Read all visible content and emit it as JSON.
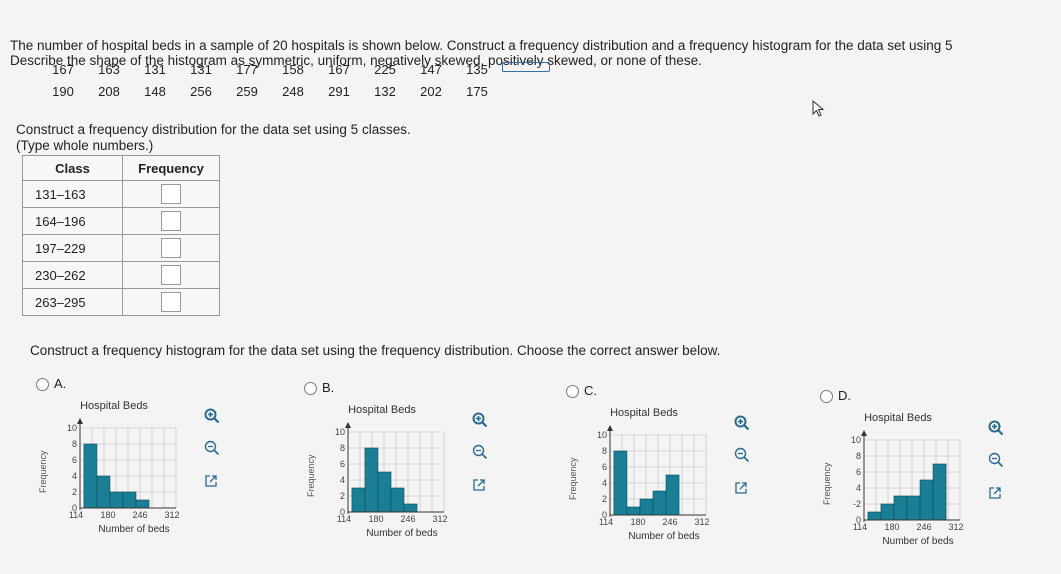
{
  "question": {
    "line1": "The number of hospital beds in a sample of 20 hospitals is shown below. Construct a frequency distribution and a frequency histogram for the data set using 5",
    "line2": "Describe the shape of the histogram as symmetric, uniform, negatively skewed, positively skewed, or none of these.",
    "row1": [
      "167",
      "163",
      "131",
      "131",
      "177",
      "158",
      "167",
      "225",
      "147",
      "135"
    ],
    "row2": [
      "190",
      "208",
      "148",
      "256",
      "259",
      "248",
      "291",
      "132",
      "202",
      "175"
    ]
  },
  "part1": {
    "prompt": "Construct a frequency distribution for the data set using 5 classes.",
    "hint": "(Type whole numbers.)",
    "table": {
      "headers": [
        "Class",
        "Frequency"
      ],
      "classes": [
        "131–163",
        "164–196",
        "197–229",
        "230–262",
        "263–295"
      ]
    }
  },
  "part2": {
    "prompt": "Construct a frequency histogram for the data set using the frequency distribution. Choose the correct answer below."
  },
  "options": [
    {
      "label": "A.",
      "title": "Hospital Beds",
      "ylabel": "Frequency",
      "xlabel": "Number of beds",
      "yticks": [
        "10",
        "8",
        "6",
        "4",
        "2",
        "0"
      ],
      "xticks": [
        "114",
        "180",
        "246",
        "312"
      ],
      "values": [
        8,
        4,
        2,
        2,
        1,
        0
      ]
    },
    {
      "label": "B.",
      "title": "Hospital Beds",
      "ylabel": "Frequency",
      "xlabel": "Number of beds",
      "yticks": [
        "10",
        "8",
        "6",
        "4",
        "2",
        "0"
      ],
      "xticks": [
        "114",
        "180",
        "246",
        "312"
      ],
      "values": [
        3,
        8,
        5,
        3,
        1,
        0
      ]
    },
    {
      "label": "C.",
      "title": "Hospital Beds",
      "ylabel": "Frequency",
      "xlabel": "Number of beds",
      "yticks": [
        "10",
        "8",
        "6",
        "4",
        "2",
        "0"
      ],
      "xticks": [
        "114",
        "180",
        "246",
        "312"
      ],
      "values": [
        8,
        1,
        2,
        3,
        5,
        0
      ]
    },
    {
      "label": "D.",
      "title": "Hospital Beds",
      "ylabel": "Frequency",
      "xlabel": "Number of beds",
      "yticks": [
        "10",
        "8",
        "6",
        "4",
        "-2",
        "0"
      ],
      "xticks": [
        "114",
        "180",
        "246",
        "312"
      ],
      "values": [
        1,
        2,
        3,
        3,
        5,
        7
      ]
    }
  ],
  "chart_data": [
    {
      "type": "bar",
      "title": "Hospital Beds",
      "xlabel": "Number of beds",
      "ylabel": "Frequency",
      "ylim": [
        0,
        10
      ],
      "categories": [
        "131-163",
        "164-196",
        "197-229",
        "230-262",
        "263-295"
      ],
      "values": [
        8,
        4,
        2,
        2,
        1
      ]
    },
    {
      "type": "bar",
      "title": "Hospital Beds",
      "xlabel": "Number of beds",
      "ylabel": "Frequency",
      "ylim": [
        0,
        10
      ],
      "categories": [
        "131-163",
        "164-196",
        "197-229",
        "230-262",
        "263-295"
      ],
      "values": [
        3,
        8,
        5,
        3,
        1
      ]
    },
    {
      "type": "bar",
      "title": "Hospital Beds",
      "xlabel": "Number of beds",
      "ylabel": "Frequency",
      "ylim": [
        0,
        10
      ],
      "categories": [
        "131-163",
        "164-196",
        "197-229",
        "230-262",
        "263-295"
      ],
      "values": [
        8,
        1,
        2,
        3,
        5
      ]
    },
    {
      "type": "bar",
      "title": "Hospital Beds",
      "xlabel": "Number of beds",
      "ylabel": "Frequency",
      "ylim": [
        0,
        10
      ],
      "categories": [
        "131-163",
        "164-196",
        "197-229",
        "230-262",
        "263-295"
      ],
      "values": [
        1,
        3,
        3,
        5,
        7
      ]
    }
  ],
  "colors": {
    "bar_fill": "#1a7f95",
    "bar_stroke": "#0b4a5a",
    "grid": "#bbbbbb",
    "icon": "#2b6a8a"
  }
}
